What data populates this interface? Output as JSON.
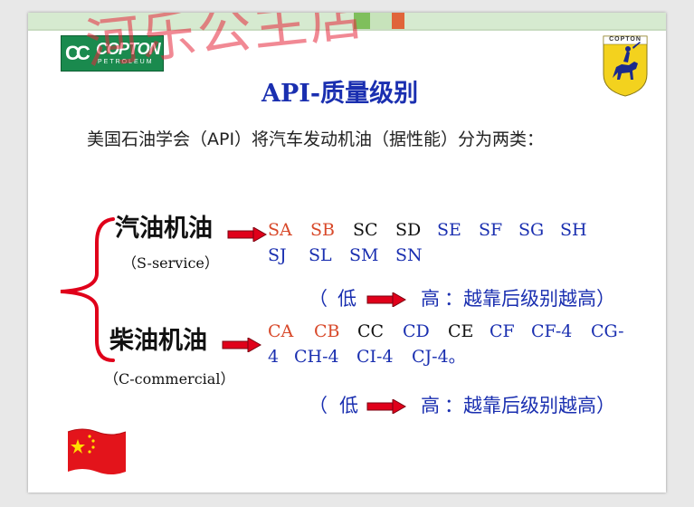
{
  "watermark": "河乐公主店",
  "logo_left": {
    "mark": "CC",
    "brand": "COPTON",
    "sub": "PETROLEUM"
  },
  "logo_right": {
    "text": "COPTON"
  },
  "title": "API-质量级别",
  "intro": "美国石油学会（API）将汽车发动机油（据性能）分为两类：",
  "colors": {
    "red": "#d8492a",
    "black": "#111111",
    "blue": "#1a2fb0",
    "arrow": "#e0001a",
    "brace": "#e0001a"
  },
  "gasoline": {
    "name": "汽油机油",
    "sub": "（S-service）",
    "grades_row1": [
      {
        "label": "SA",
        "color": "red"
      },
      {
        "label": "SB",
        "color": "red"
      },
      {
        "label": "SC",
        "color": "black"
      },
      {
        "label": "SD",
        "color": "black"
      },
      {
        "label": "SE",
        "color": "blue"
      },
      {
        "label": "SF",
        "color": "blue"
      },
      {
        "label": "SG",
        "color": "blue"
      },
      {
        "label": "SH",
        "color": "blue"
      }
    ],
    "grades_row2": [
      {
        "label": "SJ",
        "color": "blue"
      },
      {
        "label": "SL",
        "color": "blue"
      },
      {
        "label": "SM",
        "color": "blue"
      },
      {
        "label": "SN",
        "color": "blue"
      }
    ],
    "range": {
      "open": "（",
      "low": "低",
      "high": "高",
      "note": "：越靠后级别越高）"
    }
  },
  "diesel": {
    "name": "柴油机油",
    "sub": "（C-commercial）",
    "grades_row1": [
      {
        "label": "CA",
        "color": "red"
      },
      {
        "label": "CB",
        "color": "red"
      },
      {
        "label": "CC",
        "color": "black"
      },
      {
        "label": "CD",
        "color": "blue"
      },
      {
        "label": "CE",
        "color": "black"
      },
      {
        "label": "CF",
        "color": "blue"
      },
      {
        "label": "CF-4",
        "color": "blue"
      },
      {
        "label": "CG-",
        "color": "blue"
      }
    ],
    "grades_row2": [
      {
        "label": "4",
        "color": "blue"
      },
      {
        "label": "CH-4",
        "color": "blue"
      },
      {
        "label": "CI-4",
        "color": "blue"
      },
      {
        "label": "CJ-4。",
        "color": "blue"
      }
    ],
    "range": {
      "open": "（",
      "low": "低",
      "high": "高",
      "note": "：越靠后级别越高）"
    }
  }
}
